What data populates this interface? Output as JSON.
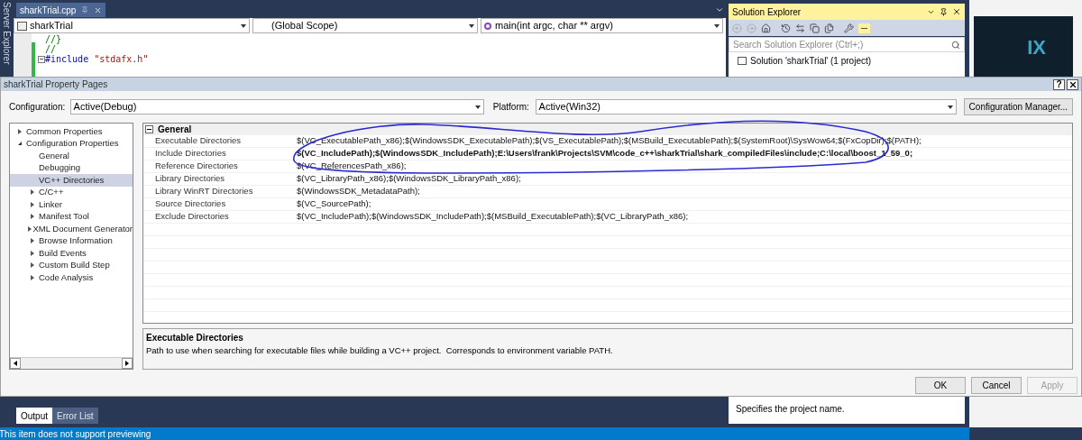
{
  "ide": {
    "side_label": "Server Explorer",
    "editor": {
      "tab": "sharkTrial.cpp",
      "nav": [
        "sharkTrial",
        "(Global Scope)",
        "main(int argc, char ** argv)"
      ],
      "code_lines": [
        {
          "kind": "comment",
          "text": "//}"
        },
        {
          "kind": "comment",
          "text": "//"
        },
        {
          "kind": "include",
          "directive": "#include",
          "arg": "\"stdafx.h\"",
          "foldable": true
        }
      ]
    },
    "solution_explorer": {
      "title": "Solution Explorer",
      "search_placeholder": "Search Solution Explorer (Ctrl+;)",
      "items": [
        "Solution 'sharkTrial' (1 project)"
      ],
      "description": "Specifies the project name."
    },
    "web_logo": "IX",
    "bottom_tabs": [
      {
        "label": "Output",
        "selected": true
      },
      {
        "label": "Error List",
        "selected": false
      }
    ],
    "status_bar": "This item does not support previewing"
  },
  "dialog": {
    "title": "sharkTrial Property Pages",
    "help_glyph": "?",
    "configuration": {
      "label": "Configuration:",
      "value": "Active(Debug)"
    },
    "platform": {
      "label": "Platform:",
      "value": "Active(Win32)"
    },
    "config_manager_button": "Configuration Manager...",
    "tree": [
      {
        "label": "Common Properties",
        "expanded": false,
        "selected": false
      },
      {
        "label": "Configuration Properties",
        "expanded": true,
        "selected": false,
        "children": [
          {
            "label": "General",
            "selected": false
          },
          {
            "label": "Debugging",
            "selected": false
          },
          {
            "label": "VC++ Directories",
            "selected": true
          },
          {
            "label": "C/C++",
            "expanded": false,
            "selected": false
          },
          {
            "label": "Linker",
            "expanded": false,
            "selected": false
          },
          {
            "label": "Manifest Tool",
            "expanded": false,
            "selected": false
          },
          {
            "label": "XML Document Generator",
            "expanded": false,
            "selected": false
          },
          {
            "label": "Browse Information",
            "expanded": false,
            "selected": false
          },
          {
            "label": "Build Events",
            "expanded": false,
            "selected": false
          },
          {
            "label": "Custom Build Step",
            "expanded": false,
            "selected": false
          },
          {
            "label": "Code Analysis",
            "expanded": false,
            "selected": false
          }
        ]
      }
    ],
    "grid": {
      "section": "General",
      "expanded": true,
      "rows": [
        {
          "name": "Executable Directories",
          "value": "$(VC_ExecutablePath_x86);$(WindowsSDK_ExecutablePath);$(VS_ExecutablePath);$(MSBuild_ExecutablePath);$(SystemRoot)\\SysWow64;$(FxCopDir);$(PATH);",
          "bold": false
        },
        {
          "name": "Include Directories",
          "value": "$(VC_IncludePath);$(WindowsSDK_IncludePath);E:\\Users\\frank\\Projects\\SVM\\code_c++\\sharkTrial\\shark_compiledFiles\\include;C:\\local\\boost_1_59_0;",
          "bold": true
        },
        {
          "name": "Reference Directories",
          "value": "$(VC_ReferencesPath_x86);",
          "bold": false
        },
        {
          "name": "Library Directories",
          "value": "$(VC_LibraryPath_x86);$(WindowsSDK_LibraryPath_x86);",
          "bold": false
        },
        {
          "name": "Library WinRT Directories",
          "value": "$(WindowsSDK_MetadataPath);",
          "bold": false
        },
        {
          "name": "Source Directories",
          "value": "$(VC_SourcePath);",
          "bold": false
        },
        {
          "name": "Exclude Directories",
          "value": "$(VC_IncludePath);$(WindowsSDK_IncludePath);$(MSBuild_ExecutablePath);$(VC_LibraryPath_x86);",
          "bold": false
        }
      ]
    },
    "description": {
      "title": "Executable Directories",
      "text": "Path to use when searching for executable files while building a VC++ project.  Corresponds to environment variable PATH."
    },
    "buttons": [
      {
        "label": "OK",
        "disabled": false
      },
      {
        "label": "Cancel",
        "disabled": false
      },
      {
        "label": "Apply",
        "disabled": true
      }
    ]
  }
}
